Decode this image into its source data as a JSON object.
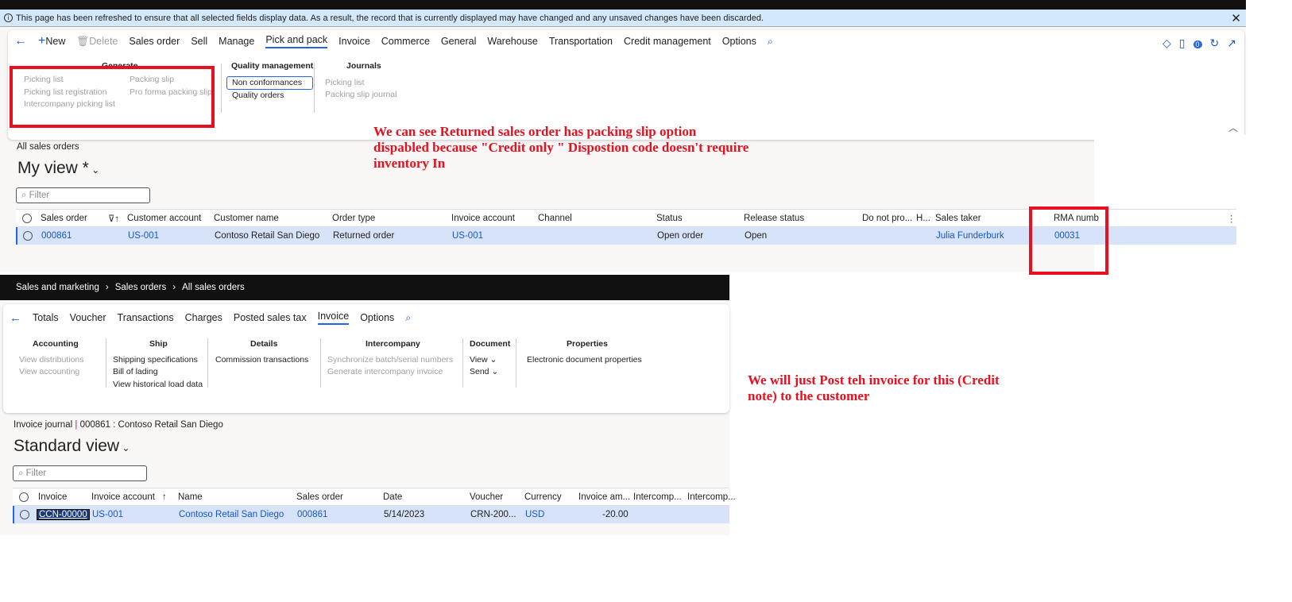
{
  "info_bar": {
    "message": "This page has been refreshed to ensure that all selected fields display data. As a result, the record that is currently displayed may have changed and any unsaved changes have been discarded."
  },
  "sales_action_pane": {
    "new": "New",
    "delete": "Delete",
    "tabs": [
      "Sales order",
      "Sell",
      "Manage",
      "Pick and pack",
      "Invoice",
      "Commerce",
      "General",
      "Warehouse",
      "Transportation",
      "Credit management",
      "Options"
    ],
    "generate_group": {
      "title": "Generate",
      "col1": [
        "Picking list",
        "Picking list registration",
        "Intercompany picking list"
      ],
      "col2": [
        "Packing slip",
        "Pro forma packing slip"
      ]
    },
    "quality_group": {
      "title": "Quality management",
      "items": [
        "Non conformances",
        "Quality orders"
      ]
    },
    "journals_group": {
      "title": "Journals",
      "items": [
        "Picking list",
        "Packing slip journal"
      ]
    },
    "badge_count": "0"
  },
  "note1": "We can see Returned sales order has packing slip option dispabled because \"Credit only \" Dispostion code doesn't require inventory In",
  "sales_list": {
    "breadcrumb": "All sales orders",
    "view": "My view *",
    "filter_placeholder": "Filter",
    "columns": [
      "Sales order",
      "Customer account",
      "Customer name",
      "Order type",
      "Invoice account",
      "Channel",
      "Status",
      "Release status",
      "Do not pro...",
      "H...",
      "Sales taker",
      "RMA numb"
    ],
    "rows": [
      {
        "sales_order": "000861",
        "customer_account": "US-001",
        "customer_name": "Contoso Retail San Diego",
        "order_type": "Returned order",
        "invoice_account": "US-001",
        "channel": "",
        "status": "Open order",
        "release_status": "Open",
        "sales_taker": "Julia Funderburk",
        "rma": "00031"
      }
    ]
  },
  "breadcrumb2": [
    "Sales and marketing",
    "Sales orders",
    "All sales orders"
  ],
  "invoice_action_pane": {
    "tabs": [
      "Totals",
      "Voucher",
      "Transactions",
      "Charges",
      "Posted sales tax",
      "Invoice",
      "Options"
    ],
    "groups": [
      {
        "title": "Accounting",
        "items": [
          "View distributions",
          "View accounting"
        ]
      },
      {
        "title": "Ship",
        "items": [
          "Shipping specifications",
          "Bill of lading",
          "View historical load data"
        ]
      },
      {
        "title": "Details",
        "items": [
          "Commission transactions"
        ]
      },
      {
        "title": "Intercompany",
        "items": [
          "Synchronize batch/serial numbers",
          "Generate intercompany invoice"
        ]
      },
      {
        "title": "Document",
        "items": [
          "View",
          "Send"
        ]
      },
      {
        "title": "Properties",
        "items": [
          "Electronic document properties"
        ]
      }
    ]
  },
  "note2": "We will just Post teh invoice for this (Credit note) to the customer",
  "invoice_list": {
    "breadcrumb": "Invoice journal",
    "record": "000861 : Contoso Retail San Diego",
    "view": "Standard view",
    "filter_placeholder": "Filter",
    "columns": [
      "Invoice",
      "Invoice account",
      "Name",
      "Sales order",
      "Date",
      "Voucher",
      "Currency",
      "Invoice am...",
      "Intercomp...",
      "Intercomp..."
    ],
    "rows": [
      {
        "invoice": "CCN-00000",
        "invoice_account": "US-001",
        "name": "Contoso Retail San Diego",
        "sales_order": "000861",
        "date": "5/14/2023",
        "voucher": "CRN-200...",
        "currency": "USD",
        "amount": "-20.00"
      }
    ]
  }
}
